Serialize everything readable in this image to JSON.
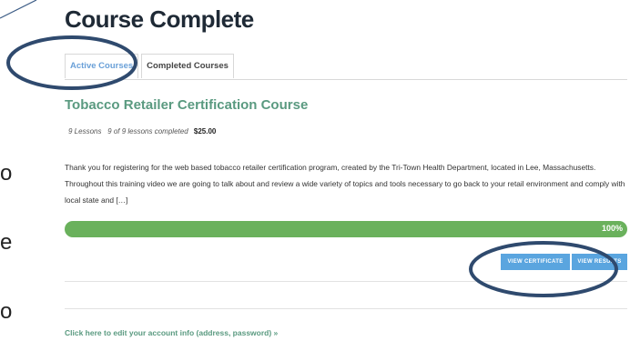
{
  "page": {
    "title": "Course Complete"
  },
  "side_text": [
    "o",
    "e",
    "o"
  ],
  "tabs": [
    {
      "label": "Active Courses"
    },
    {
      "label": "Completed Courses"
    }
  ],
  "course": {
    "title": "Tobacco Retailer Certification Course",
    "lessons": "9 Lessons",
    "completed": "9 of 9 lessons completed",
    "price": "$25.00",
    "description": "Thank you for registering for the web based tobacco retailer certification program, created by the Tri-Town Health Department, located in Lee, Massachusetts. Throughout this training video we are going to talk about and review a wide variety of topics and tools necessary to go back to your retail environment and comply with local state and […]",
    "progress": 1.0,
    "progress_label": "100%"
  },
  "buttons": {
    "certificate": "VIEW CERTIFICATE",
    "results": "VIEW RESULTS"
  },
  "links": {
    "edit_account": "Click here to edit your account info (address, password) »"
  },
  "colors": {
    "accent_green": "#5a9a80",
    "progress_green": "#6ab15c",
    "button_blue": "#5aa5df",
    "annotation_navy": "#2f4a6e"
  }
}
